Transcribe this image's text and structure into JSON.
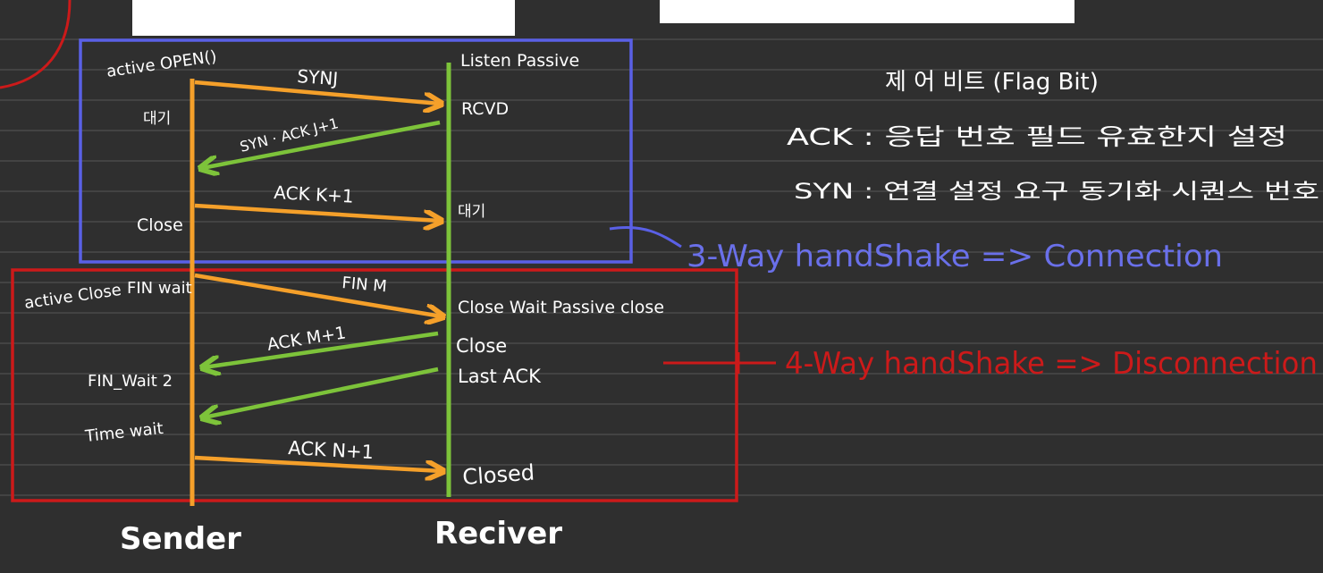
{
  "sender": {
    "title": "Sender",
    "states": {
      "active_open": "active OPEN()",
      "wait1": "대기",
      "close": "Close",
      "active_close": "active Close",
      "fin_wait": "FIN wait",
      "fin_wait2": "FIN_Wait 2",
      "time_wait": "Time wait"
    }
  },
  "receiver": {
    "title": "Reciver",
    "states": {
      "listen": "Listen Passive",
      "rcvd": "RCVD",
      "wait": "대기",
      "close_wait": "Close Wait Passive close",
      "close": "Close",
      "last_ack": "Last ACK",
      "closed": "Closed"
    }
  },
  "messages": {
    "syn": "SYNJ",
    "syn_ack": "SYN · ACK J+1",
    "ack_k": "ACK K+1",
    "fin_m": "FIN M",
    "ack_m": "ACK M+1",
    "ack_n": "ACK N+1"
  },
  "notes": {
    "heading": "제 어 비트 (Flag Bit)",
    "ack": "ACK : 응답 번호 필드 유효한지 설정",
    "syn": "SYN : 연결 설정 요구 동기화 시퀀스 번호"
  },
  "annotations": {
    "handshake3": "3-Way handShake => Connection",
    "handshake4": "4-Way handShake => Disconnection"
  },
  "colors": {
    "background": "#2f2f2f",
    "sender_line": "#f5a02a",
    "receiver_line": "#7dc33a",
    "connection_box": "#5a60e6",
    "disconnection_box": "#cc1a1a"
  }
}
